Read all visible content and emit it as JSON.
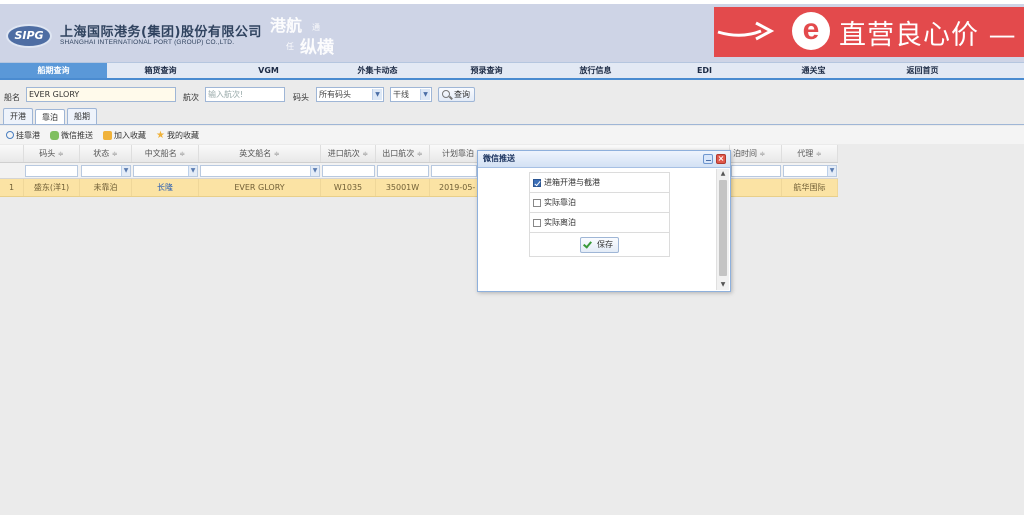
{
  "header": {
    "logo_badge": "SIPG",
    "company_cn": "上海国际港务(集团)股份有限公司",
    "company_en": "SHANGHAI INTERNATIONAL PORT (GROUP) CO.,LTD.",
    "slogan_a": "港航",
    "slogan_b": "通",
    "slogan_c": "任",
    "slogan_d": "纵横",
    "banner_letter": "e",
    "banner_text": "直营良心价 —"
  },
  "nav": {
    "items": [
      {
        "label": "船期查询",
        "active": true
      },
      {
        "label": "箱货查询"
      },
      {
        "label": "VGM"
      },
      {
        "label": "外集卡动态"
      },
      {
        "label": "预录查询"
      },
      {
        "label": "放行信息"
      },
      {
        "label": "EDI"
      },
      {
        "label": "通关宝"
      },
      {
        "label": "返回首页"
      }
    ]
  },
  "search": {
    "ship_label": "船名",
    "ship_value": "EVER GLORY",
    "voyage_label": "航次",
    "voyage_placeholder": "输入航次!",
    "terminal_label": "码头",
    "terminal_value": "所有码头",
    "line_value": "干线",
    "search_button": "查询"
  },
  "tabs": [
    {
      "label": "开港"
    },
    {
      "label": "靠泊",
      "active": true
    },
    {
      "label": "船期"
    }
  ],
  "toolbar": {
    "items": [
      "挂靠港",
      "微信推送",
      "加入收藏",
      "我的收藏"
    ]
  },
  "grid": {
    "headers": [
      "码头",
      "状态",
      "中文船名",
      "英文船名",
      "进口航次",
      "出口航次",
      "计划靠泊",
      "泊时间",
      "代理"
    ],
    "row": {
      "index": "1",
      "terminal": "盛东(洋1)",
      "status": "未靠泊",
      "cn_name": "长隆",
      "en_name": "EVER GLORY",
      "import_voyage": "W1035",
      "export_voyage": "35001W",
      "plan_berth": "2019-05-",
      "agent": "航华国际"
    }
  },
  "dialog": {
    "title": "微信推送",
    "options": [
      {
        "label": "进箱开港与截港",
        "checked": true
      },
      {
        "label": "实际靠泊",
        "checked": false
      },
      {
        "label": "实际离泊",
        "checked": false
      }
    ],
    "save_label": "保存"
  }
}
